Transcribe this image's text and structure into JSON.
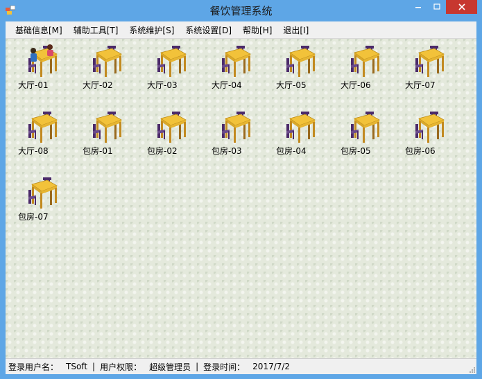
{
  "window": {
    "title": "餐饮管理系统",
    "controls": {
      "minimize": "─",
      "maximize": "□",
      "close": "✕"
    }
  },
  "menu": [
    {
      "label": "基础信息[M]"
    },
    {
      "label": "辅助工具[T]"
    },
    {
      "label": "系统维护[S]"
    },
    {
      "label": "系统设置[D]"
    },
    {
      "label": "帮助[H]"
    },
    {
      "label": "退出[I]"
    }
  ],
  "tables": [
    {
      "label": "大厅-01",
      "state": "occupied"
    },
    {
      "label": "大厅-02",
      "state": "free"
    },
    {
      "label": "大厅-03",
      "state": "free"
    },
    {
      "label": "大厅-04",
      "state": "free"
    },
    {
      "label": "大厅-05",
      "state": "free"
    },
    {
      "label": "大厅-06",
      "state": "free"
    },
    {
      "label": "大厅-07",
      "state": "free"
    },
    {
      "label": "大厅-08",
      "state": "free"
    },
    {
      "label": "包房-01",
      "state": "free"
    },
    {
      "label": "包房-02",
      "state": "free"
    },
    {
      "label": "包房-03",
      "state": "free"
    },
    {
      "label": "包房-04",
      "state": "free"
    },
    {
      "label": "包房-05",
      "state": "free"
    },
    {
      "label": "包房-06",
      "state": "free"
    },
    {
      "label": "包房-07",
      "state": "free"
    }
  ],
  "status": {
    "user_label": "登录用户名：",
    "user_value": "TSoft",
    "separator": "|",
    "permission_label": "用户权限：",
    "permission_value": "超级管理员",
    "time_label": "登录时间：",
    "time_value": "2017/7/2"
  },
  "colors": {
    "titlebar": "#5ea6e6",
    "close_button": "#c7372f",
    "table_top": "#f2c23a",
    "chair_back": "#4b2a6a"
  }
}
